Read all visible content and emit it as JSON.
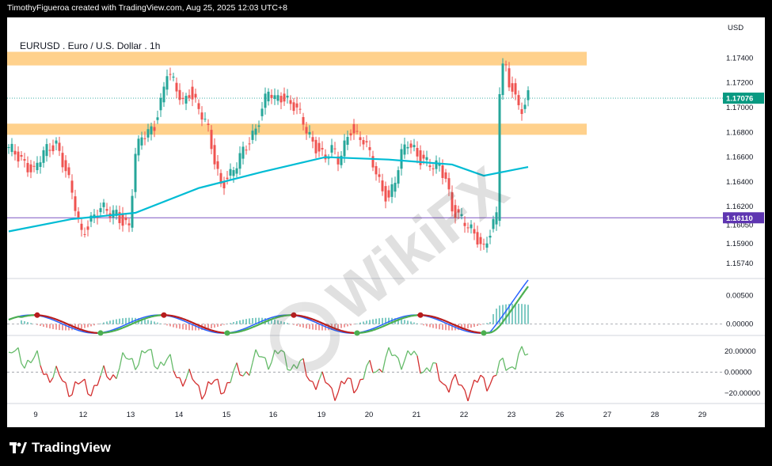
{
  "header": {
    "credit": "TimothyFigueroa created with TradingView.com, Aug 25, 2025 12:03 UTC+8"
  },
  "footer": {
    "brand_name": "TradingView"
  },
  "watermark": {
    "text": "WikiFX"
  },
  "colors": {
    "background": "#ffffff",
    "frame": "#000000",
    "candle_up": "#26a69a",
    "candle_down": "#ef5350",
    "sma": "#00bcd4",
    "zone": "#ffcc80",
    "support_line": "#7e57c2",
    "macd_line": "#2962ff",
    "signal_up": "#4caf50",
    "signal_down": "#b71c1c",
    "osc_up": "#66bb6a",
    "osc_down": "#d32f2f"
  },
  "chart_data": {
    "type": "candlestick",
    "title": "EURUSD . Euro / U.S. Dollar . 1h",
    "symbol": "EURUSD",
    "timeframe": "1h",
    "currency_label": "USD",
    "x_ticks": [
      "9",
      "12",
      "13",
      "14",
      "15",
      "16",
      "19",
      "20",
      "21",
      "22",
      "23",
      "26",
      "27",
      "28",
      "29"
    ],
    "price_axis": {
      "ylim": [
        1.1562,
        1.176
      ],
      "ticks": [
        "1.17400",
        "1.17200",
        "1.17000",
        "1.16800",
        "1.16600",
        "1.16400",
        "1.16200",
        "1.16050",
        "1.15900",
        "1.15740"
      ]
    },
    "current_price": "1.17076",
    "support_level": "1.16110",
    "resistance_zones": [
      {
        "low": 1.1734,
        "high": 1.1745
      },
      {
        "low": 1.1678,
        "high": 1.1687
      }
    ],
    "price_path": [
      {
        "x": 0,
        "close": 1.1665
      },
      {
        "x": 4,
        "close": 1.166
      },
      {
        "x": 8,
        "close": 1.1648
      },
      {
        "x": 11,
        "close": 1.1662
      },
      {
        "x": 15,
        "close": 1.1673
      },
      {
        "x": 18,
        "close": 1.165
      },
      {
        "x": 21,
        "close": 1.1618
      },
      {
        "x": 23,
        "close": 1.1597
      },
      {
        "x": 26,
        "close": 1.1612
      },
      {
        "x": 29,
        "close": 1.1618
      },
      {
        "x": 32,
        "close": 1.1613
      },
      {
        "x": 34,
        "close": 1.1615
      },
      {
        "x": 36,
        "close": 1.161
      },
      {
        "x": 38,
        "close": 1.1605
      },
      {
        "x": 40,
        "close": 1.166
      },
      {
        "x": 42,
        "close": 1.1675
      },
      {
        "x": 44,
        "close": 1.168
      },
      {
        "x": 46,
        "close": 1.1688
      },
      {
        "x": 48,
        "close": 1.1705
      },
      {
        "x": 50,
        "close": 1.1728
      },
      {
        "x": 52,
        "close": 1.1718
      },
      {
        "x": 55,
        "close": 1.1705
      },
      {
        "x": 57,
        "close": 1.1715
      },
      {
        "x": 59,
        "close": 1.1704
      },
      {
        "x": 61,
        "close": 1.1692
      },
      {
        "x": 63,
        "close": 1.168
      },
      {
        "x": 65,
        "close": 1.1658
      },
      {
        "x": 67,
        "close": 1.164
      },
      {
        "x": 70,
        "close": 1.1645
      },
      {
        "x": 72,
        "close": 1.1652
      },
      {
        "x": 75,
        "close": 1.167
      },
      {
        "x": 78,
        "close": 1.1685
      },
      {
        "x": 80,
        "close": 1.1698
      },
      {
        "x": 82,
        "close": 1.1712
      },
      {
        "x": 84,
        "close": 1.1705
      },
      {
        "x": 86,
        "close": 1.171
      },
      {
        "x": 88,
        "close": 1.1708
      },
      {
        "x": 90,
        "close": 1.1702
      },
      {
        "x": 92,
        "close": 1.1692
      },
      {
        "x": 94,
        "close": 1.168
      },
      {
        "x": 96,
        "close": 1.1672
      },
      {
        "x": 98,
        "close": 1.1668
      },
      {
        "x": 100,
        "close": 1.166
      },
      {
        "x": 102,
        "close": 1.1665
      },
      {
        "x": 104,
        "close": 1.1655
      },
      {
        "x": 106,
        "close": 1.167
      },
      {
        "x": 108,
        "close": 1.1685
      },
      {
        "x": 110,
        "close": 1.1678
      },
      {
        "x": 112,
        "close": 1.1672
      },
      {
        "x": 114,
        "close": 1.166
      },
      {
        "x": 116,
        "close": 1.1648
      },
      {
        "x": 118,
        "close": 1.1635
      },
      {
        "x": 120,
        "close": 1.1628
      },
      {
        "x": 122,
        "close": 1.164
      },
      {
        "x": 124,
        "close": 1.166
      },
      {
        "x": 126,
        "close": 1.1672
      },
      {
        "x": 128,
        "close": 1.1668
      },
      {
        "x": 130,
        "close": 1.166
      },
      {
        "x": 132,
        "close": 1.1655
      },
      {
        "x": 134,
        "close": 1.165
      },
      {
        "x": 136,
        "close": 1.1652
      },
      {
        "x": 138,
        "close": 1.1645
      },
      {
        "x": 140,
        "close": 1.162
      },
      {
        "x": 142,
        "close": 1.1612
      },
      {
        "x": 144,
        "close": 1.1605
      },
      {
        "x": 146,
        "close": 1.16
      },
      {
        "x": 148,
        "close": 1.1596
      },
      {
        "x": 150,
        "close": 1.1588
      },
      {
        "x": 152,
        "close": 1.16
      },
      {
        "x": 154,
        "close": 1.161
      },
      {
        "x": 155,
        "close": 1.1712
      },
      {
        "x": 156,
        "close": 1.1735
      },
      {
        "x": 157,
        "close": 1.173
      },
      {
        "x": 158,
        "close": 1.1718
      },
      {
        "x": 159,
        "close": 1.172
      },
      {
        "x": 160,
        "close": 1.1712
      },
      {
        "x": 161,
        "close": 1.17
      },
      {
        "x": 162,
        "close": 1.1698
      },
      {
        "x": 163,
        "close": 1.1704
      },
      {
        "x": 164,
        "close": 1.17076
      }
    ],
    "sma_path": [
      {
        "x": 0,
        "value": 1.16
      },
      {
        "x": 20,
        "value": 1.161
      },
      {
        "x": 40,
        "value": 1.1615
      },
      {
        "x": 60,
        "value": 1.1635
      },
      {
        "x": 80,
        "value": 1.1648
      },
      {
        "x": 100,
        "value": 1.166
      },
      {
        "x": 120,
        "value": 1.1658
      },
      {
        "x": 140,
        "value": 1.1654
      },
      {
        "x": 150,
        "value": 1.1645
      },
      {
        "x": 160,
        "value": 1.165
      },
      {
        "x": 164,
        "value": 1.1652
      }
    ],
    "indicator_1": {
      "axis_ticks": [
        "0.00500",
        "0.00000"
      ],
      "ylim": [
        -0.002,
        0.008
      ]
    },
    "indicator_2": {
      "axis_ticks": [
        "20.00000",
        "0.00000",
        "−20.00000"
      ],
      "ylim": [
        -30,
        35
      ]
    }
  }
}
